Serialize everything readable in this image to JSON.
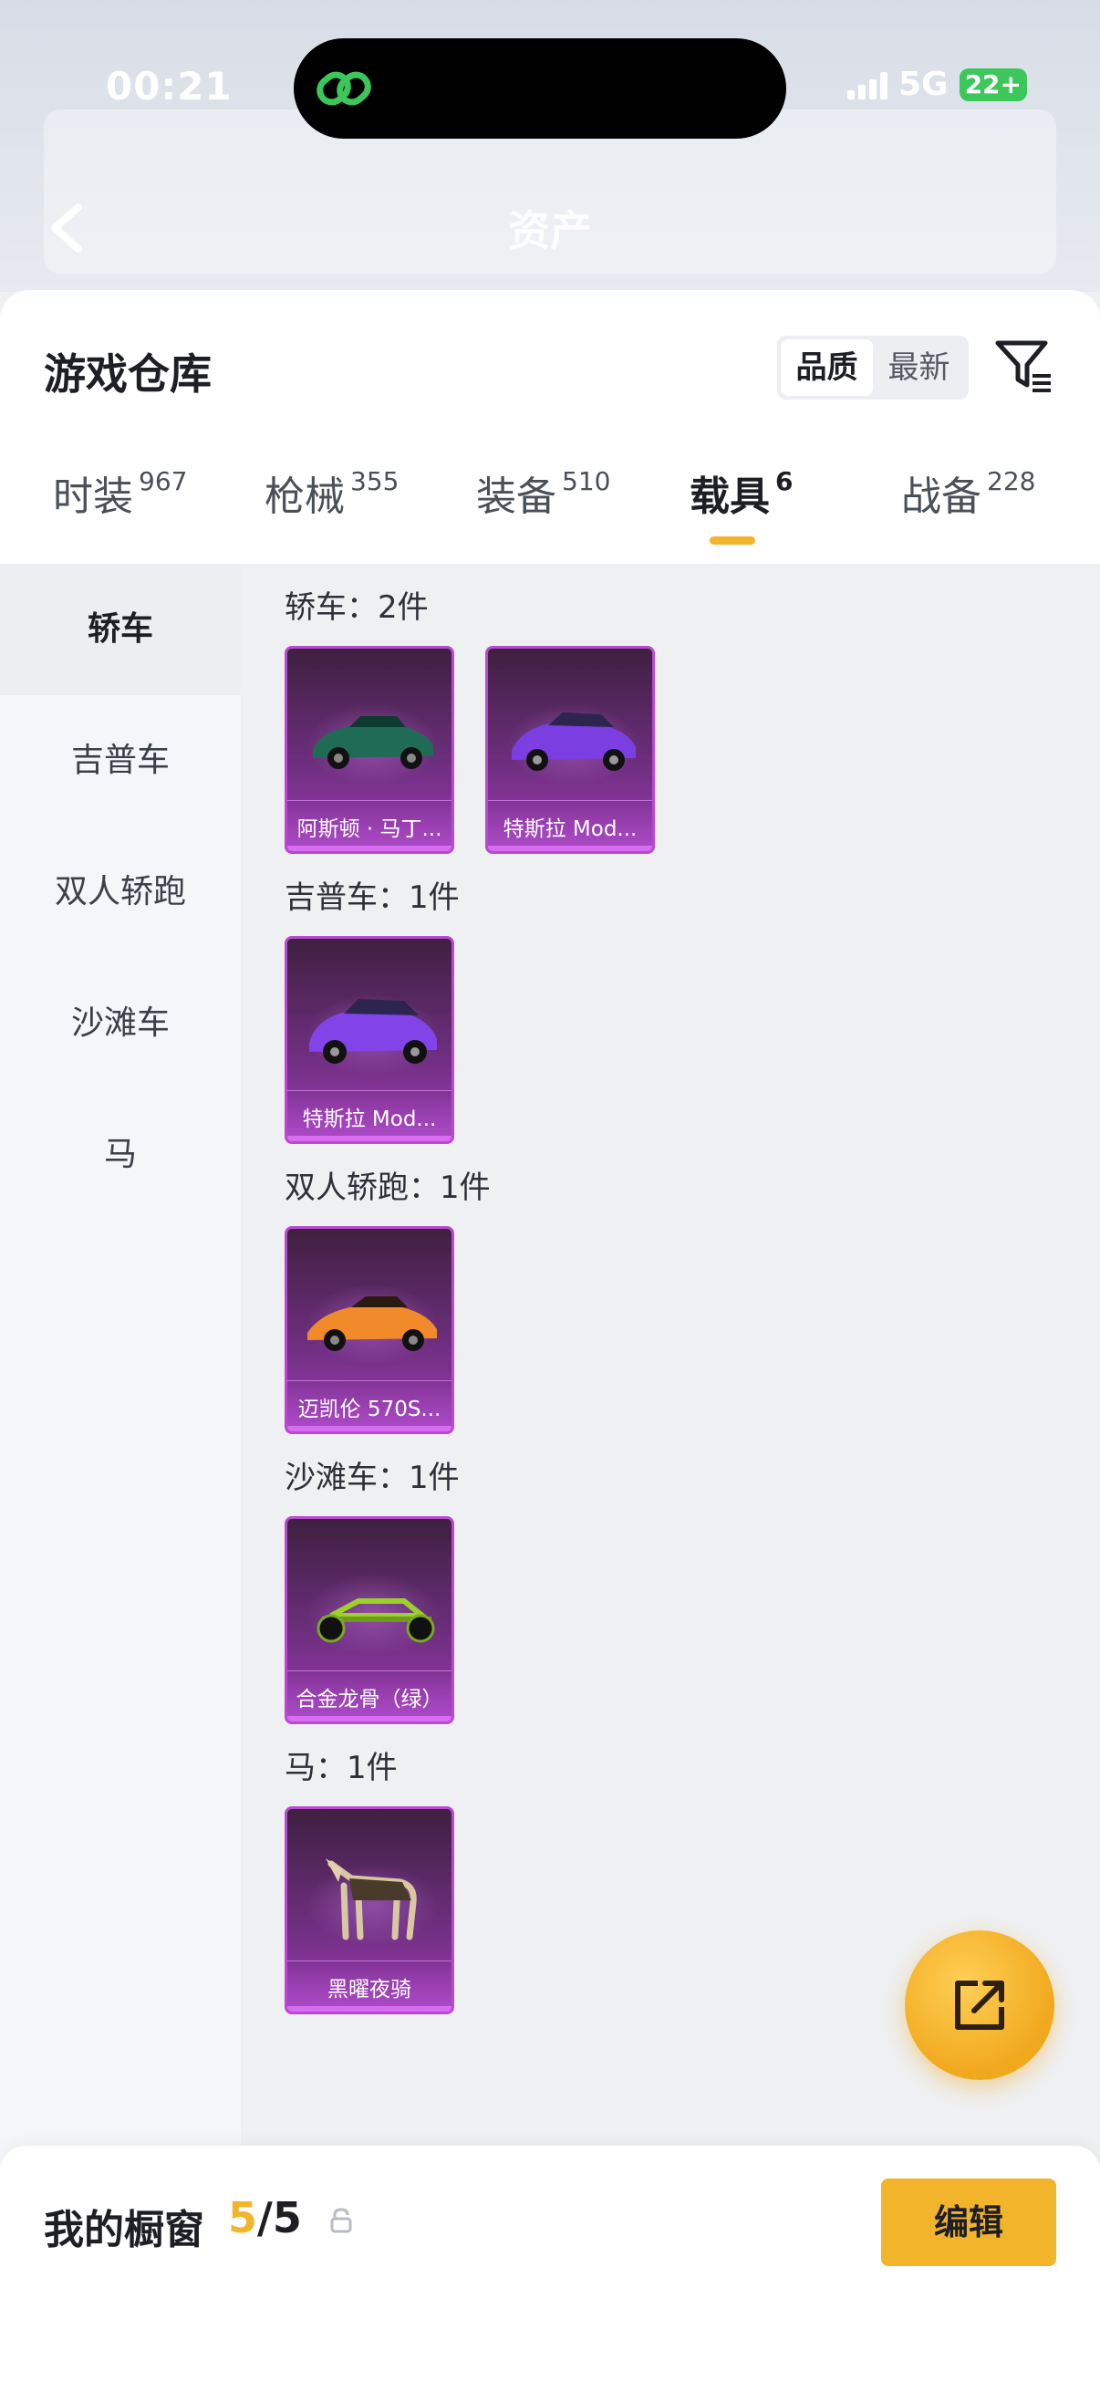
{
  "status_bar": {
    "time": "00:21",
    "network": "5G",
    "battery": "22+"
  },
  "header": {
    "title": "资产"
  },
  "warehouse": {
    "title": "游戏仓库",
    "sort_options": [
      "品质",
      "最新"
    ],
    "sort_selected": "品质"
  },
  "tabs": [
    {
      "label": "时装",
      "count": "967"
    },
    {
      "label": "枪械",
      "count": "355"
    },
    {
      "label": "装备",
      "count": "510"
    },
    {
      "label": "载具",
      "count": "6"
    },
    {
      "label": "战备",
      "count": "228"
    }
  ],
  "active_tab": "载具",
  "categories": [
    "轿车",
    "吉普车",
    "双人轿跑",
    "沙滩车",
    "马"
  ],
  "active_category": "轿车",
  "sections": [
    {
      "title": "轿车：2件",
      "items": [
        {
          "name": "阿斯顿 · 马丁...",
          "art": "green-car"
        },
        {
          "name": "特斯拉 Mod...",
          "art": "purple-sedan"
        }
      ]
    },
    {
      "title": "吉普车：1件",
      "items": [
        {
          "name": "特斯拉 Mod...",
          "art": "purple-suv"
        }
      ]
    },
    {
      "title": "双人轿跑：1件",
      "items": [
        {
          "name": "迈凯伦 570S...",
          "art": "orange-coupe"
        }
      ]
    },
    {
      "title": "沙滩车：1件",
      "items": [
        {
          "name": "合金龙骨（绿）",
          "art": "green-buggy"
        }
      ]
    },
    {
      "title": "马：1件",
      "items": [
        {
          "name": "黑曜夜骑",
          "art": "armored-horse"
        }
      ]
    }
  ],
  "bottom": {
    "label": "我的橱窗",
    "current": "5",
    "total": "/5",
    "edit_label": "编辑"
  },
  "colors": {
    "accent": "#f2b42b",
    "card_purple": "#9b3bb3",
    "card_border": "#b84ad1"
  },
  "icons": [
    "back-chevron-icon",
    "filter-icon",
    "share-icon",
    "lock-icon",
    "link-icon"
  ]
}
